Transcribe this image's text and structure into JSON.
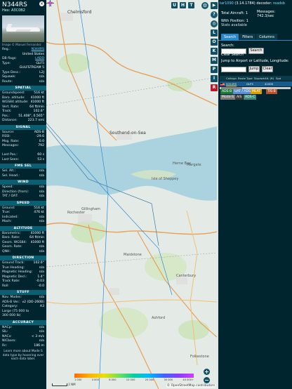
{
  "left_panel": {
    "callsign": "N344RS",
    "hex_label": "Hex:",
    "hex": "A3C0B2",
    "photo_credit": "Image © Manuel Fernandez",
    "reg_rows": [
      {
        "k": "Reg.:",
        "v": "N344RS",
        "link": true
      },
      {
        "k": "",
        "v": "United States",
        "link": false
      },
      {
        "k": "DB flags:",
        "v": "LADD",
        "link": true
      },
      {
        "k": "Type:",
        "v": "GLF5",
        "link": false
      },
      {
        "k": "",
        "v": "GULFSTREAM 5",
        "link": false
      },
      {
        "k": "Type Desc.:",
        "v": "L2J",
        "link": false
      },
      {
        "k": "Squawk:",
        "v": "n/a",
        "link": false
      },
      {
        "k": "Route:",
        "v": "n/a",
        "link": false
      }
    ],
    "sections": [
      {
        "title": "SPATIAL",
        "rows": [
          {
            "k": "Groundspeed:",
            "v": "516 kt"
          },
          {
            "k": "Baro. altitude:",
            "v": "41000 ft"
          },
          {
            "k": "WGS84 altitude:",
            "v": "41000 ft"
          },
          {
            "k": "Vert. Rate:",
            "v": "64 ft/min"
          },
          {
            "k": "Track:",
            "v": "102.6°"
          },
          {
            "k": "Pos.:",
            "v": "51.408°, 0.565°"
          },
          {
            "k": "Distance:",
            "v": "223.7 nmi"
          }
        ]
      },
      {
        "title": "SIGNAL",
        "rows": [
          {
            "k": "Source:",
            "v": "ADS-B"
          },
          {
            "k": "RSSI:",
            "v": "-29.6"
          },
          {
            "k": "Msg. Rate:",
            "v": "0.0"
          },
          {
            "k": "Messages:",
            "v": "792"
          },
          {
            "k": "",
            "v": ""
          },
          {
            "k": "Last Pos.:",
            "v": "60 s"
          },
          {
            "k": "Last Seen:",
            "v": "53 s"
          }
        ]
      },
      {
        "title": "FMS SEL",
        "rows": [
          {
            "k": "Sel. Alt.:",
            "v": "n/a"
          },
          {
            "k": "Sel. Head.:",
            "v": "n/a"
          }
        ]
      },
      {
        "title": "WIND",
        "rows": [
          {
            "k": "Speed:",
            "v": "n/a"
          },
          {
            "k": "Direction (from):",
            "v": "n/a"
          },
          {
            "k": "TAT / OAT:",
            "v": "n/a"
          }
        ]
      },
      {
        "title": "SPEED",
        "rows": [
          {
            "k": "Ground:",
            "v": "516 kt"
          },
          {
            "k": "True:",
            "v": "476 kt"
          },
          {
            "k": "Indicated:",
            "v": "n/a"
          },
          {
            "k": "Mach:",
            "v": "n/a"
          }
        ]
      },
      {
        "title": "ALTITUDE",
        "rows": [
          {
            "k": "Barometric:",
            "v": "41000 ft"
          },
          {
            "k": "Baro. Rate:",
            "v": "64 ft/min"
          },
          {
            "k": "Geom. WGS84:",
            "v": "41000 ft"
          },
          {
            "k": "Geom. Rate:",
            "v": "n/a"
          },
          {
            "k": "QNH:",
            "v": "n/a"
          }
        ]
      },
      {
        "title": "DIRECTION",
        "rows": [
          {
            "k": "Ground Track:",
            "v": "102.6°"
          },
          {
            "k": "True Heading:",
            "v": "n/a"
          },
          {
            "k": "Magnetic Heading:",
            "v": "n/a"
          },
          {
            "k": "Magnetic Decl.:",
            "v": "1.4°"
          },
          {
            "k": "Track Rate:",
            "v": "-0.03"
          },
          {
            "k": "Roll:",
            "v": "-0.0"
          }
        ]
      },
      {
        "title": "STUFF",
        "rows": [
          {
            "k": "Nav. Modes:",
            "v": "n/a"
          },
          {
            "k": "ADS-B Ver.:",
            "v": "v2 (DO-260B)"
          },
          {
            "k": "Category:",
            "v": "A3"
          },
          {
            "k": "Large (75 000 to",
            "v": ""
          },
          {
            "k": "300 000 lb)",
            "v": ""
          }
        ]
      },
      {
        "title": "ACCURACY",
        "rows": [
          {
            "k": "NACp:",
            "v": "n/a"
          },
          {
            "k": "SIL:",
            "v": "n/a"
          },
          {
            "k": "NACv:",
            "v": "< 3 m/s"
          },
          {
            "k": "NICbaro:",
            "v": "n/a"
          },
          {
            "k": "Rc:",
            "v": "186 m"
          }
        ]
      }
    ],
    "footer": "Learn more about Mode S data type by hovering over each data label."
  },
  "map": {
    "top_buttons": [
      "U",
      "H",
      "T"
    ],
    "labels": [
      {
        "text": "Chelmsford",
        "big": true
      },
      {
        "text": "Southend-on-Sea",
        "big": true
      },
      {
        "text": "Isle of Sheppey",
        "big": false
      },
      {
        "text": "Margate",
        "big": false
      },
      {
        "text": "Rochester",
        "big": false
      },
      {
        "text": "Gillingham",
        "big": false
      },
      {
        "text": "Maidstone",
        "big": false
      },
      {
        "text": "Canterbury",
        "big": false
      },
      {
        "text": "Ashford",
        "big": false
      },
      {
        "text": "Folkestone",
        "big": false
      },
      {
        "text": "Herne Bay",
        "big": false
      }
    ],
    "scale": "2 NM",
    "altitude_ticks": [
      "1 000",
      "4 000",
      "8 000",
      "10 000",
      "20 000",
      "30 000",
      "40 000+"
    ],
    "attribution": "© OpenStreetMap contributors"
  },
  "strip_buttons": [
    "L",
    "O",
    "K",
    "M",
    "P",
    "I",
    "R"
  ],
  "strip_extra": [
    "▶",
    "?"
  ],
  "right_panel": {
    "app": "tar1090",
    "version": "(3.14.1784)",
    "decoder": "decoder:",
    "decoder_link": "readsb",
    "total_label": "Total Aircraft:",
    "total": "1",
    "messages_label": "Messages:",
    "messages": "742.3/sec",
    "with_position_label": "With Position:",
    "with_position": "1",
    "stats_label": "Stats available",
    "tabs": [
      "Search",
      "Filters",
      "Columns"
    ],
    "search_label": "Search:",
    "search_button": "Search",
    "clear_search": "Clear Search",
    "jump_label": "Jump to Airport or Latitude, Longitude:",
    "jump_button": "Jump",
    "clear_button": "Clear",
    "columns": [
      "",
      "Callsign",
      "Route",
      "Type",
      "Squawk",
      "Alt. (ft)",
      "Spd"
    ],
    "row": {
      "callsign": "N344RS",
      "route": "",
      "type": "GLF5",
      "squawk": "",
      "alt": "41000",
      "spd": ""
    },
    "legend": [
      {
        "text": "ADS-B",
        "color": "#1c7a3b"
      },
      {
        "text": "UAT / ADS-R",
        "color": "#5a8fd6"
      },
      {
        "text": "MLAT",
        "color": "#d9a000"
      },
      {
        "text": "TIS-B",
        "color": "#b7522c"
      },
      {
        "text": "Mode-S",
        "color": "#7a7a7a"
      },
      {
        "text": "AIS",
        "color": "#3a3a3a"
      },
      {
        "text": "ADS-C",
        "color": "#3c8c7d"
      }
    ]
  }
}
